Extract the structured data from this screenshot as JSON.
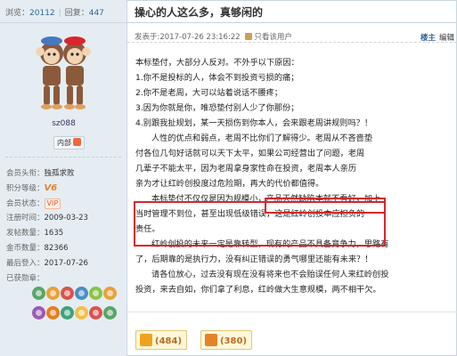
{
  "stats": {
    "views_label": "浏览：",
    "views": "20112",
    "replies_label": "回复：",
    "replies": "447"
  },
  "thread": {
    "title": "操心的人这么多，真够闲的"
  },
  "user": {
    "name": "sz088",
    "group_badge": "内部",
    "info": [
      {
        "label": "会员头衔：",
        "value": "独孤求败"
      },
      {
        "label": "积分等级：",
        "value": "V6"
      },
      {
        "label": "会员状态：",
        "value": "VIP"
      },
      {
        "label": "注册时间：",
        "value": "2009-03-23"
      },
      {
        "label": "发帖数量：",
        "value": "1635"
      },
      {
        "label": "金币数量：",
        "value": "82366"
      },
      {
        "label": "最后登入：",
        "value": "2017-07-26"
      },
      {
        "label": "已获勋章：",
        "value": ""
      }
    ],
    "medal_colors": [
      "#5aa469",
      "#e8a23b",
      "#d9534f",
      "#4a90c2",
      "#8bc34a",
      "#e8a23b",
      "#9b59b6",
      "#e67e22",
      "#3fa37a",
      "#f0c04a",
      "#d9534f",
      "#5aa469"
    ]
  },
  "post": {
    "meta": "发表于:2017-07-26 23:16:22",
    "author_only": "只看该用户",
    "floor_label": "楼主",
    "edit_label": "编辑",
    "lines": [
      "本标垫付，大部分人反对。不外乎以下原因：",
      "1.你不是投标的人，体会不到投资亏损的痛；",
      "2.你不是老周，大可以站着说话不腰疼；",
      "3.因为你就是你，唯恐垫付别人少了你那份；",
      "4.别跟我扯规划，某一天损伤到你本人，会来跟老周讲规则吗？！",
      "人性的优点和弱点，老周不比你们了解得少。老周从不吝啬垫",
      "付各位几句好话就可以天下太平，如果公司经营出了问题，老周",
      "几辈子不能太平，因为老周拿身家性命在投资，老周本人亲历",
      "亲为才让红岭创投度过危险期，再大的代价都值得。",
      "本标垫付不仅仅是因为规模小，产品天然缺陷本就不看好，加上",
      "当时管理不到位，甚至出现低级错误，这是红岭创投本应担负的",
      "责任。",
      "红岭创投的未来一定是靠转型，现有的产品不具备竞争力，思路有",
      "了，后期靠的是执行力，没有纠正错误的勇气哪里还能有未来？！",
      "请各位放心，过去没有现在没有将来也不会贻误任何人来红岭创投",
      "投资，来去自如，你们拿了利息，红岭做大生意规模，两不相干欠。"
    ]
  },
  "votes": {
    "up": "(484)",
    "down": "(380)"
  }
}
